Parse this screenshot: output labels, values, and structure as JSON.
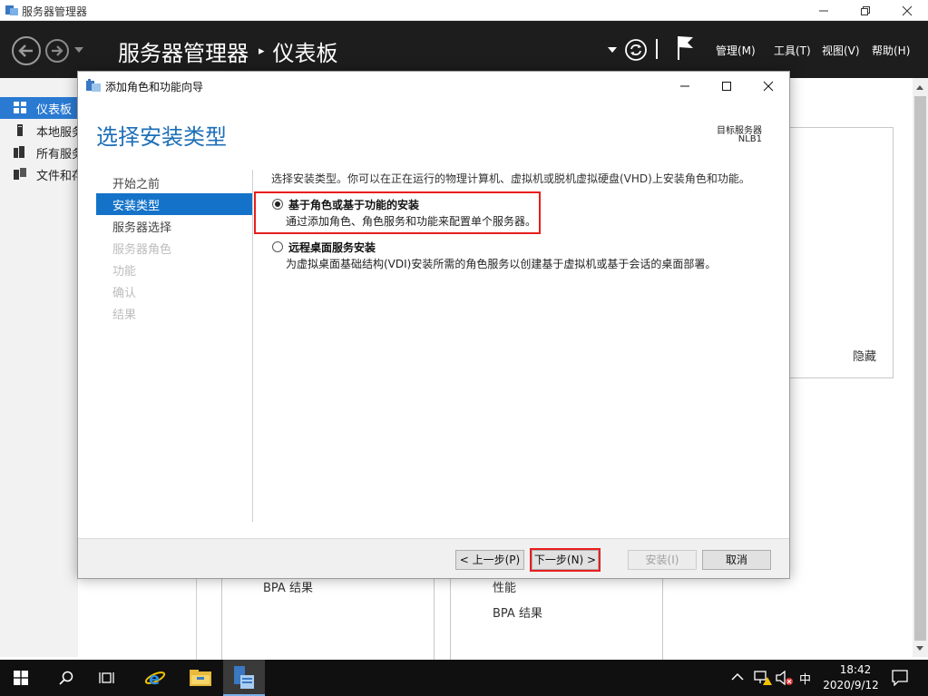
{
  "window": {
    "title": "服务器管理器"
  },
  "header": {
    "breadcrumb_root": "服务器管理器",
    "breadcrumb_sep": "▸",
    "breadcrumb_current": "仪表板",
    "menus": [
      "管理(M)",
      "工具(T)",
      "视图(V)",
      "帮助(H)"
    ]
  },
  "sidebar": {
    "items": [
      {
        "label": "仪表板",
        "icon": "dashboard-icon",
        "active": true
      },
      {
        "label": "本地服务器",
        "icon": "local-server-icon",
        "active": false
      },
      {
        "label": "所有服务器",
        "icon": "all-servers-icon",
        "active": false
      },
      {
        "label": "文件和存储服务",
        "icon": "file-storage-icon",
        "active": false
      }
    ]
  },
  "background": {
    "hide_link": "隐藏",
    "panel1_row": "BPA 结果",
    "panel2_rows": [
      "性能",
      "BPA 结果"
    ]
  },
  "dialog": {
    "title": "添加角色和功能向导",
    "heading": "选择安装类型",
    "destination_label": "目标服务器",
    "destination_server": "NLB1",
    "steps": [
      {
        "label": "开始之前",
        "state": "normal"
      },
      {
        "label": "安装类型",
        "state": "active"
      },
      {
        "label": "服务器选择",
        "state": "normal"
      },
      {
        "label": "服务器角色",
        "state": "dim"
      },
      {
        "label": "功能",
        "state": "dim"
      },
      {
        "label": "确认",
        "state": "dim"
      },
      {
        "label": "结果",
        "state": "dim"
      }
    ],
    "intro": "选择安装类型。你可以在正在运行的物理计算机、虚拟机或脱机虚拟硬盘(VHD)上安装角色和功能。",
    "options": [
      {
        "title": "基于角色或基于功能的安装",
        "description": "通过添加角色、角色服务和功能来配置单个服务器。",
        "selected": true
      },
      {
        "title": "远程桌面服务安装",
        "description": "为虚拟桌面基础结构(VDI)安装所需的角色服务以创建基于虚拟机或基于会话的桌面部署。",
        "selected": false
      }
    ],
    "buttons": {
      "previous": "< 上一步(P)",
      "next": "下一步(N) >",
      "install": "安装(I)",
      "cancel": "取消"
    },
    "highlight_color": "#e81e1e",
    "accent_color": "#1473c9"
  },
  "taskbar": {
    "ime": "中",
    "time": "18:42",
    "date": "2020/9/12"
  }
}
